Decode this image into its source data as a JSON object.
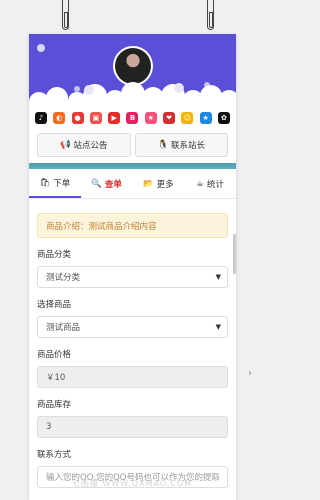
{
  "apps": [
    {
      "name": "tiktok-icon",
      "color": "#111111",
      "glyph": "♪"
    },
    {
      "name": "app-orange-icon",
      "color": "#f36b21",
      "glyph": "◐"
    },
    {
      "name": "app-red-icon",
      "color": "#e53935",
      "glyph": "●"
    },
    {
      "name": "app-red2-icon",
      "color": "#ef5350",
      "glyph": "▣"
    },
    {
      "name": "youtube-icon",
      "color": "#e52d27",
      "glyph": "▶"
    },
    {
      "name": "app-pink-icon",
      "color": "#e91e63",
      "glyph": "B"
    },
    {
      "name": "app-violet-icon",
      "color": "#ff4f7b",
      "glyph": "★"
    },
    {
      "name": "app-red3-icon",
      "color": "#d32f2f",
      "glyph": "❤"
    },
    {
      "name": "app-yellow-icon",
      "color": "#f2b600",
      "glyph": "☺"
    },
    {
      "name": "app-blue-icon",
      "color": "#1e88e5",
      "glyph": "★"
    },
    {
      "name": "qq-icon",
      "color": "#111111",
      "glyph": "✿"
    }
  ],
  "buttons": {
    "announcement": "站点公告",
    "contact": "联系站长"
  },
  "tabs": [
    {
      "label": "下单",
      "icon": "🛍"
    },
    {
      "label": "查单",
      "icon": "🔍"
    },
    {
      "label": "更多",
      "icon": "📂"
    },
    {
      "label": "统计",
      "icon": "☕"
    }
  ],
  "notice": "商品介绍：测试商品介绍内容",
  "form": {
    "category_label": "商品分类",
    "category_value": "测试分类",
    "product_label": "选择商品",
    "product_value": "测试商品",
    "price_label": "商品价格",
    "price_value": "￥10",
    "stock_label": "商品库存",
    "stock_value": "3",
    "contact_label": "联系方式",
    "contact_placeholder": "输入您的QQ,您的QQ号码也可以作为您的提取卡密"
  },
  "watermark": "七图猫  WWW.QXMAO.COM"
}
